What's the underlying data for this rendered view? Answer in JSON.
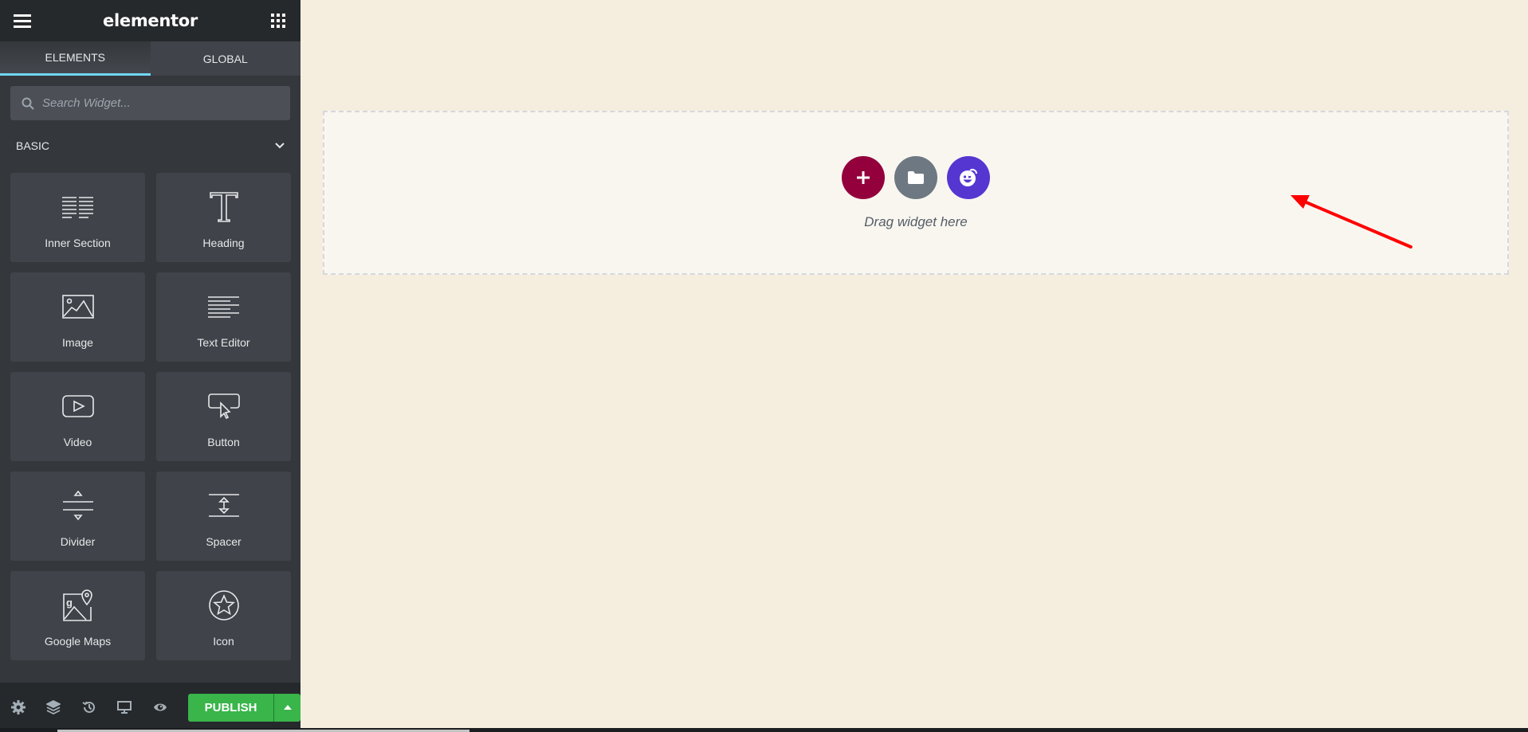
{
  "header": {
    "logo": "elementor",
    "menu_icon": "hamburger-menu-icon",
    "apps_icon": "grid-apps-icon"
  },
  "tabs": [
    {
      "label": "ELEMENTS",
      "active": true
    },
    {
      "label": "GLOBAL",
      "active": false
    }
  ],
  "search": {
    "placeholder": "Search Widget...",
    "value": ""
  },
  "category": {
    "label": "BASIC",
    "expanded": true
  },
  "widgets": [
    {
      "label": "Inner Section",
      "icon": "inner-section-icon"
    },
    {
      "label": "Heading",
      "icon": "heading-icon"
    },
    {
      "label": "Image",
      "icon": "image-icon"
    },
    {
      "label": "Text Editor",
      "icon": "text-editor-icon"
    },
    {
      "label": "Video",
      "icon": "video-icon"
    },
    {
      "label": "Button",
      "icon": "button-icon"
    },
    {
      "label": "Divider",
      "icon": "divider-icon"
    },
    {
      "label": "Spacer",
      "icon": "spacer-icon"
    },
    {
      "label": "Google Maps",
      "icon": "google-maps-icon"
    },
    {
      "label": "Icon",
      "icon": "star-icon"
    }
  ],
  "footer": {
    "icons": [
      "settings-icon",
      "navigator-layers-icon",
      "history-icon",
      "responsive-mode-icon",
      "preview-icon"
    ],
    "publish_label": "PUBLISH"
  },
  "canvas": {
    "drop_text": "Drag widget here",
    "buttons": [
      "add-section",
      "add-template",
      "template-kit"
    ]
  },
  "colors": {
    "accent_tab": "#71d7f7",
    "publish": "#39b54a",
    "add_section": "#93003c",
    "add_template": "#6d7882",
    "kit": "#5636d1",
    "annotation_arrow": "#ff0000"
  }
}
